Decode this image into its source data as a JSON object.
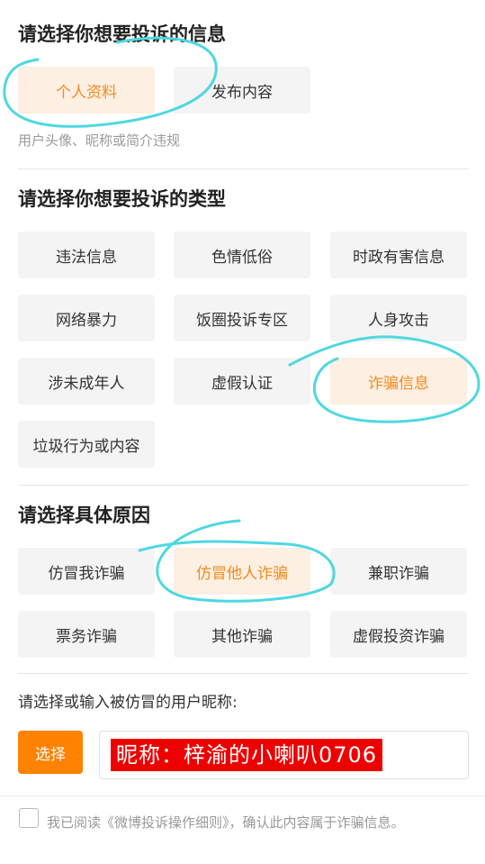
{
  "info_section": {
    "title": "请选择你想要投诉的信息",
    "options": [
      {
        "label": "个人资料",
        "selected": true
      },
      {
        "label": "发布内容",
        "selected": false
      }
    ],
    "hint": "用户头像、昵称或简介违规"
  },
  "type_section": {
    "title": "请选择你想要投诉的类型",
    "options": [
      {
        "label": "违法信息",
        "selected": false
      },
      {
        "label": "色情低俗",
        "selected": false
      },
      {
        "label": "时政有害信息",
        "selected": false
      },
      {
        "label": "网络暴力",
        "selected": false
      },
      {
        "label": "饭圈投诉专区",
        "selected": false
      },
      {
        "label": "人身攻击",
        "selected": false
      },
      {
        "label": "涉未成年人",
        "selected": false
      },
      {
        "label": "虚假认证",
        "selected": false
      },
      {
        "label": "诈骗信息",
        "selected": true
      },
      {
        "label": "垃圾行为或内容",
        "selected": false
      }
    ]
  },
  "reason_section": {
    "title": "请选择具体原因",
    "options": [
      {
        "label": "仿冒我诈骗",
        "selected": false
      },
      {
        "label": "仿冒他人诈骗",
        "selected": true
      },
      {
        "label": "兼职诈骗",
        "selected": false
      },
      {
        "label": "票务诈骗",
        "selected": false
      },
      {
        "label": "其他诈骗",
        "selected": false
      },
      {
        "label": "虚假投资诈骗",
        "selected": false
      }
    ]
  },
  "nickname_section": {
    "label": "请选择或输入被仿冒的用户昵称:",
    "select_button": "选择",
    "input_value": "昵称：梓渝的小喇叭0706"
  },
  "agreement": {
    "text": "我已阅读《微博投诉操作细则》，确认此内容属于诈骗信息。",
    "checked": false
  },
  "colors": {
    "accent": "#ff8200",
    "selected_text": "#f08c1e",
    "selected_bg": "#fdefe2",
    "chip_bg": "#f4f4f4",
    "annotation": "#4fd8e0",
    "redaction": "#ee0000"
  }
}
